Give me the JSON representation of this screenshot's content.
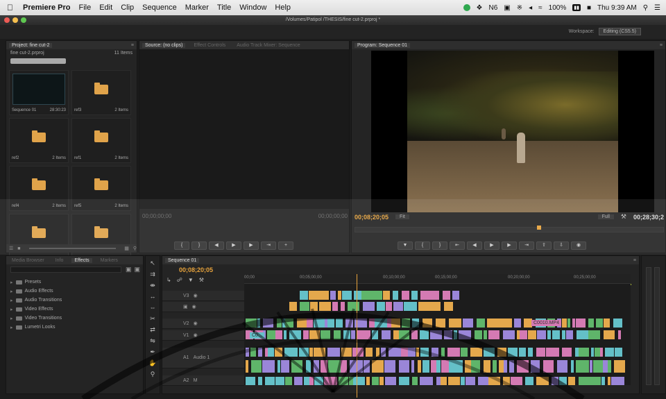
{
  "menubar": {
    "apple": "",
    "app": "Premiere Pro",
    "items": [
      "File",
      "Edit",
      "Clip",
      "Sequence",
      "Marker",
      "Title",
      "Window",
      "Help"
    ],
    "status_icons": [
      "N6",
      "100%"
    ],
    "clock": "Thu 9:39 AM"
  },
  "window": {
    "title": "/Volumes/Patipol /THESIS/fine cut-2.prproj *"
  },
  "workspace": {
    "label": "Workspace:",
    "value": "Editing (CS5.5)"
  },
  "project": {
    "tab": "Project: fine cut-2",
    "file": "fine cut-2.prproj",
    "count": "11 Items",
    "bins": [
      {
        "type": "sequence",
        "label": "Sequence 01",
        "count": "28:30:23"
      },
      {
        "type": "folder",
        "label": "ref3",
        "count": "2 Items"
      },
      {
        "type": "folder",
        "label": "ref2",
        "count": "2 Items"
      },
      {
        "type": "folder",
        "label": "ref1",
        "count": "2 Items"
      },
      {
        "type": "folder",
        "label": "ref4",
        "count": "2 Items"
      },
      {
        "type": "folder",
        "label": "ref5",
        "count": "2 Items"
      },
      {
        "type": "folder",
        "label": "",
        "count": ""
      },
      {
        "type": "folder",
        "label": "",
        "count": ""
      }
    ]
  },
  "source": {
    "tabs": [
      "Source: (no clips)",
      "Effect Controls",
      "Audio Track Mixer: Sequence"
    ],
    "tc_left": "00;00;00;00",
    "tc_right": "00;00;00;00"
  },
  "program": {
    "tab": "Program: Sequence 01",
    "tc_current": "00;08;20;05",
    "fit": "Fit",
    "full": "Full",
    "tc_duration": "00;28;30;2"
  },
  "effects": {
    "tabs": [
      "Media Browser",
      "Info",
      "Effects",
      "Markers"
    ],
    "items": [
      "Presets",
      "Audio Effects",
      "Audio Transitions",
      "Video Effects",
      "Video Transitions",
      "Lumetri Looks"
    ]
  },
  "timeline": {
    "tab": "Sequence 01",
    "tc": "00;08;20;05",
    "ruler": [
      "00;00",
      "00;05;00;00",
      "00;10;00;00",
      "00;15;00;00",
      "00;20;00;00",
      "00;25;00;00"
    ],
    "tracks": [
      "V3",
      "V2",
      "V1",
      "A1",
      "A2"
    ],
    "audio_label": "Audio 1",
    "clip_label": "C0010.MP4",
    "clip_label_v1": "C0..."
  },
  "colors": {
    "playhead": "#e8a33c",
    "clip_cyan": "#64c0c8",
    "clip_pink": "#d47ab3",
    "clip_orange": "#e4a84c",
    "clip_violet": "#9a86d8",
    "clip_green": "#5fb56a"
  }
}
